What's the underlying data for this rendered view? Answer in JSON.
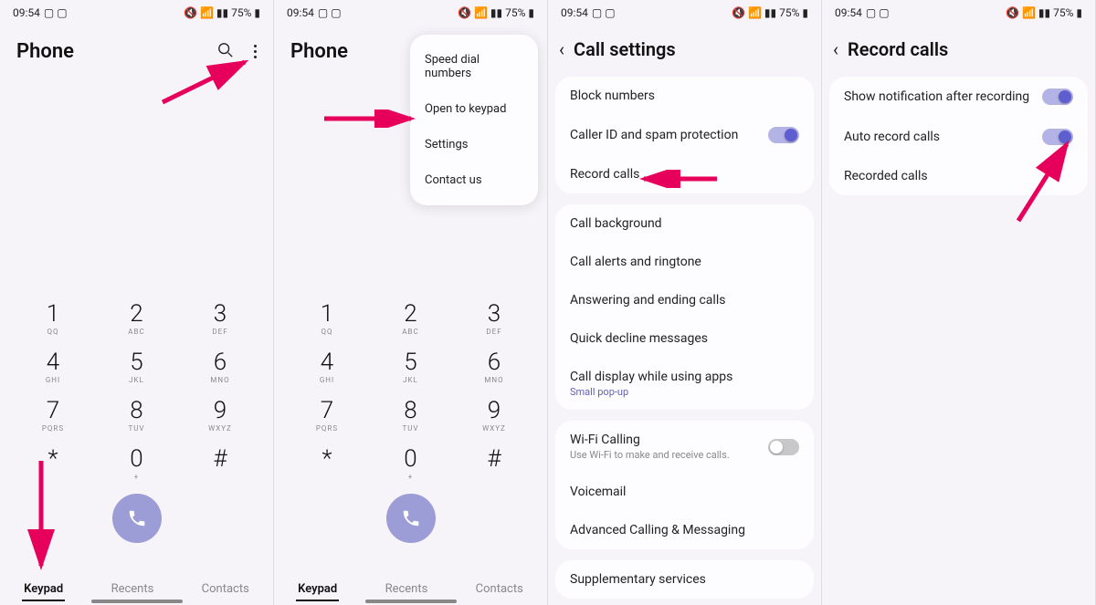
{
  "status": {
    "time": "09:54",
    "battery": "75%"
  },
  "phone": {
    "title": "Phone",
    "keys": [
      {
        "n": "1",
        "s": "QQ"
      },
      {
        "n": "2",
        "s": "ABC"
      },
      {
        "n": "3",
        "s": "DEF"
      },
      {
        "n": "4",
        "s": "GHI"
      },
      {
        "n": "5",
        "s": "JKL"
      },
      {
        "n": "6",
        "s": "MNO"
      },
      {
        "n": "7",
        "s": "PQRS"
      },
      {
        "n": "8",
        "s": "TUV"
      },
      {
        "n": "9",
        "s": "WXYZ"
      },
      {
        "n": "*",
        "s": ""
      },
      {
        "n": "0",
        "s": "+"
      },
      {
        "n": "#",
        "s": ""
      }
    ],
    "tabs": {
      "keypad": "Keypad",
      "recents": "Recents",
      "contacts": "Contacts"
    }
  },
  "menu": {
    "speed_dial": "Speed dial numbers",
    "open_keypad": "Open to keypad",
    "settings": "Settings",
    "contact_us": "Contact us"
  },
  "call_settings": {
    "title": "Call settings",
    "block": "Block numbers",
    "caller_id": "Caller ID and spam protection",
    "record": "Record calls",
    "background": "Call background",
    "alerts": "Call alerts and ringtone",
    "answering": "Answering and ending calls",
    "decline": "Quick decline messages",
    "display": "Call display while using apps",
    "display_sub": "Small pop-up",
    "wifi": "Wi-Fi Calling",
    "wifi_sub": "Use Wi-Fi to make and receive calls.",
    "voicemail": "Voicemail",
    "advanced": "Advanced Calling & Messaging",
    "supplementary": "Supplementary services"
  },
  "record_calls": {
    "title": "Record calls",
    "show_notif": "Show notification after recording",
    "auto": "Auto record calls",
    "recorded": "Recorded calls"
  },
  "colors": {
    "arrow": "#e6005c"
  }
}
